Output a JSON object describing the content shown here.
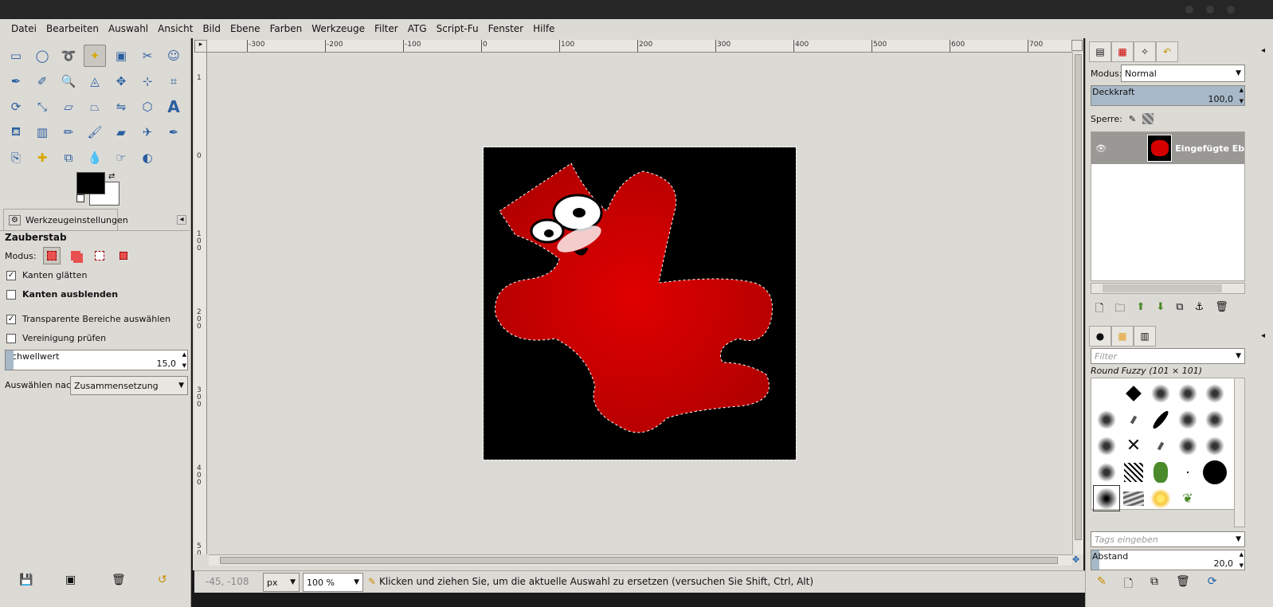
{
  "menubar": {
    "items": [
      "Datei",
      "Bearbeiten",
      "Auswahl",
      "Ansicht",
      "Bild",
      "Ebene",
      "Farben",
      "Werkzeuge",
      "Filter",
      "ATG",
      "Script-Fu",
      "Fenster",
      "Hilfe"
    ]
  },
  "toolbox": {
    "tools": [
      "rect-select-icon",
      "ellipse-select-icon",
      "lasso-icon",
      "magic-wand-icon",
      "select-by-color-icon",
      "scissors-icon",
      "foreground-select-icon",
      "paths-icon",
      "color-picker-icon",
      "zoom-icon",
      "measure-icon",
      "move-icon",
      "align-icon",
      "crop-icon",
      "rotate-icon",
      "scale-icon",
      "shear-icon",
      "perspective-icon",
      "flip-icon",
      "cage-icon",
      "text-icon",
      "bucket-fill-icon",
      "blend-icon",
      "pencil-icon",
      "paintbrush-icon",
      "eraser-icon",
      "airbrush-icon",
      "ink-icon",
      "clone-icon",
      "heal-icon",
      "perspective-clone-icon",
      "blur-icon",
      "smudge-icon",
      "dodge-burn-icon"
    ],
    "active_tool_index": 3
  },
  "tool_options": {
    "tab_label": "Werkzeugeinstellungen",
    "tool_name": "Zauberstab",
    "mode_label": "Modus:",
    "antialias_label": "Kanten glätten",
    "antialias_checked": true,
    "feather_label": "Kanten ausblenden",
    "feather_checked": false,
    "transparent_label": "Transparente Bereiche auswählen",
    "transparent_checked": true,
    "sample_merged_label": "Vereinigung prüfen",
    "sample_merged_checked": false,
    "threshold_label": "Schwellwert",
    "threshold_value": "15,0",
    "select_by_label": "Auswählen nach:",
    "select_by_value": "Zusammensetzung"
  },
  "ruler": {
    "h_labels": [
      "-300",
      "-200",
      "-100",
      "0",
      "100",
      "200",
      "300",
      "400",
      "500",
      "600",
      "700"
    ],
    "v_labels": [
      "1",
      "0",
      "1\n0\n0",
      "2\n0\n0",
      "3\n0\n0",
      "4\n0\n0",
      "5\n0"
    ]
  },
  "statusbar": {
    "coords": "-45, -108",
    "unit": "px",
    "zoom": "100 %",
    "message": "Klicken und ziehen Sie, um die aktuelle Auswahl zu ersetzen (versuchen Sie Shift, Ctrl, Alt)"
  },
  "layers_panel": {
    "mode_label": "Modus:",
    "mode_value": "Normal",
    "opacity_label": "Deckkraft",
    "opacity_value": "100,0",
    "lock_label": "Sperre:",
    "layer_name": "Eingefügte Ebe"
  },
  "brushes_panel": {
    "filter_placeholder": "Filter",
    "brush_name": "Round Fuzzy (101 × 101)",
    "tags_placeholder": "Tags eingeben",
    "spacing_label": "Abstand",
    "spacing_value": "20,0"
  },
  "colors": {
    "ui_bg": "#dcdad5",
    "foreground": "#000000",
    "background": "#ffffff",
    "image_red": "#d40000"
  }
}
